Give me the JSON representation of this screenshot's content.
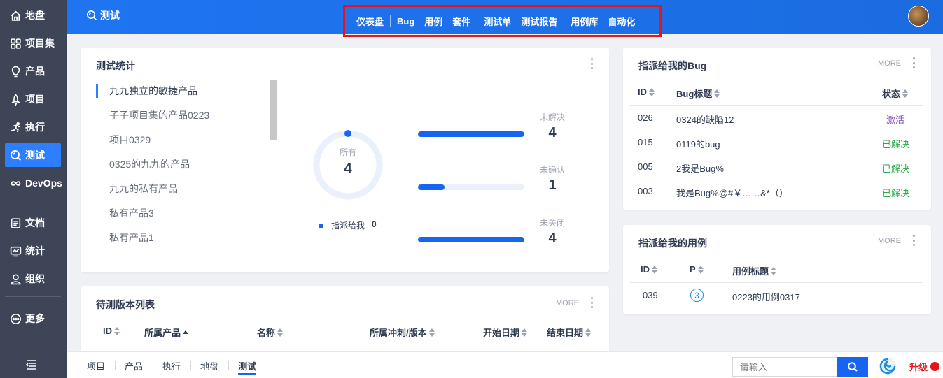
{
  "sidebar": {
    "items": [
      {
        "label": "地盘",
        "icon": "home-icon"
      },
      {
        "label": "项目集",
        "icon": "grid-icon"
      },
      {
        "label": "产品",
        "icon": "lightbulb-icon"
      },
      {
        "label": "项目",
        "icon": "rocket-icon"
      },
      {
        "label": "执行",
        "icon": "running-icon"
      },
      {
        "label": "测试",
        "icon": "test-search-icon"
      },
      {
        "label": "DevOps",
        "icon": "infinity-icon"
      },
      {
        "label": "文档",
        "icon": "document-icon"
      },
      {
        "label": "统计",
        "icon": "chart-icon"
      },
      {
        "label": "组织",
        "icon": "user-icon"
      },
      {
        "label": "更多",
        "icon": "more-icon"
      }
    ],
    "active_index": 5
  },
  "header": {
    "title": "测试",
    "nav": [
      "仪表盘",
      "Bug",
      "用例",
      "套件",
      "测试单",
      "测试报告",
      "用例库",
      "自动化"
    ],
    "current_nav": "仪表盘"
  },
  "test_stats": {
    "title": "测试统计",
    "products": [
      "九九独立的敏捷产品",
      "子子项目集的产品0223",
      "项目0329",
      "0325的九九的产品",
      "九九的私有产品",
      "私有产品3",
      "私有产品1"
    ],
    "ring": {
      "label": "所有",
      "value": "4"
    },
    "assigned": {
      "label": "指派给我",
      "value": "0"
    },
    "stats": [
      {
        "label": "未解决",
        "value": "4",
        "fraction": 1.0
      },
      {
        "label": "未确认",
        "value": "1",
        "fraction": 0.25
      },
      {
        "label": "未关闭",
        "value": "4",
        "fraction": 1.0
      }
    ]
  },
  "build_list": {
    "title": "待测版本列表",
    "more": "MORE",
    "columns": [
      "ID",
      "所属产品",
      "名称",
      "所属冲刺/版本",
      "开始日期",
      "结束日期"
    ]
  },
  "my_bugs": {
    "title": "指派给我的Bug",
    "more": "MORE",
    "columns": [
      "ID",
      "Bug标题",
      "状态"
    ],
    "rows": [
      {
        "id": "026",
        "title": "0324的缺陷12",
        "status": "激活",
        "status_type": "active"
      },
      {
        "id": "015",
        "title": "0119的bug",
        "status": "已解决",
        "status_type": "resolved"
      },
      {
        "id": "005",
        "title": "2我是Bug%",
        "status": "已解决",
        "status_type": "resolved"
      },
      {
        "id": "003",
        "title": "我是Bug%@#￥……&*（）",
        "status": "已解决",
        "status_type": "resolved"
      }
    ]
  },
  "my_cases": {
    "title": "指派给我的用例",
    "more": "MORE",
    "columns": [
      "ID",
      "P",
      "用例标题"
    ],
    "rows": [
      {
        "id": "039",
        "priority": "3",
        "title": "0223的用例0317"
      }
    ]
  },
  "bottom_bar": {
    "crumbs": [
      "项目",
      "产品",
      "执行",
      "地盘",
      "测试"
    ],
    "current_crumb": "测试",
    "search_placeholder": "请输入",
    "upgrade_label": "升级"
  },
  "colors": {
    "brand": "#1565f2",
    "sidebar_bg": "#3d4557",
    "highlight_border": "#e8131b"
  }
}
